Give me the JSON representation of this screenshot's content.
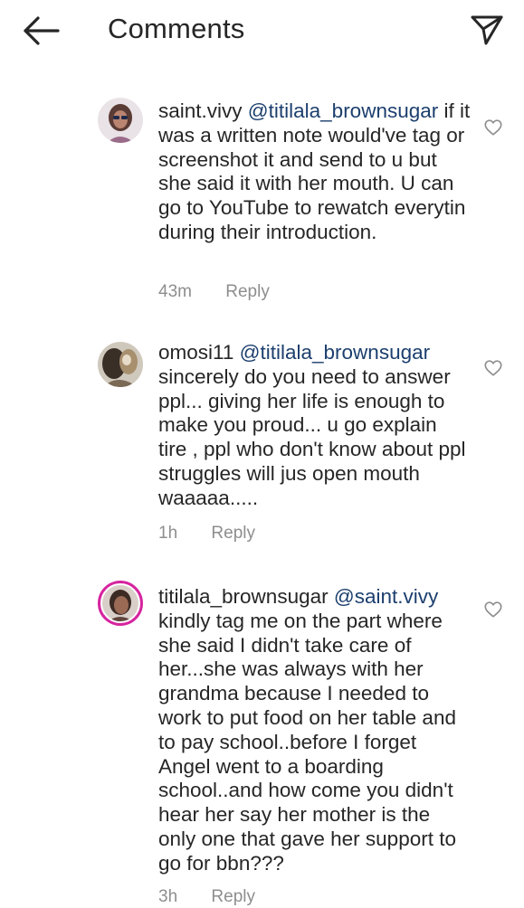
{
  "header": {
    "title": "Comments",
    "back_icon": "arrow-left-icon",
    "share_icon": "paper-plane-icon"
  },
  "comments": [
    {
      "username": "saint.vivy",
      "mention": "@titilala_brownsugar",
      "text": "if it was a written note would've tag or screenshot it and send to u but she said it with her mouth. U can go to YouTube to rewatch everytin  during their introduction.",
      "time": "43m",
      "reply": "Reply"
    },
    {
      "username": "omosi11",
      "mention": "@titilala_brownsugar",
      "text": "sincerely do you need to answer ppl... giving her life is enough to make you proud... u go explain tire , ppl who don't know about ppl struggles will jus open mouth waaaaa.....",
      "time": "1h",
      "reply": "Reply"
    },
    {
      "username": "titilala_brownsugar",
      "mention": "@saint.vivy",
      "text": "kindly tag me on the part where she said I didn't take care of her...she was always with her grandma because I needed to work to put food on her table and to pay school..before I forget Angel went to a boarding school..and how come you didn't hear her say her mother is the only one that gave her support to go for bbn???",
      "time": "3h",
      "reply": "Reply"
    }
  ],
  "colors": {
    "text": "#262626",
    "mention": "#1c3f6e",
    "meta": "#8e8e8e",
    "story_ring": "#d6249f"
  }
}
